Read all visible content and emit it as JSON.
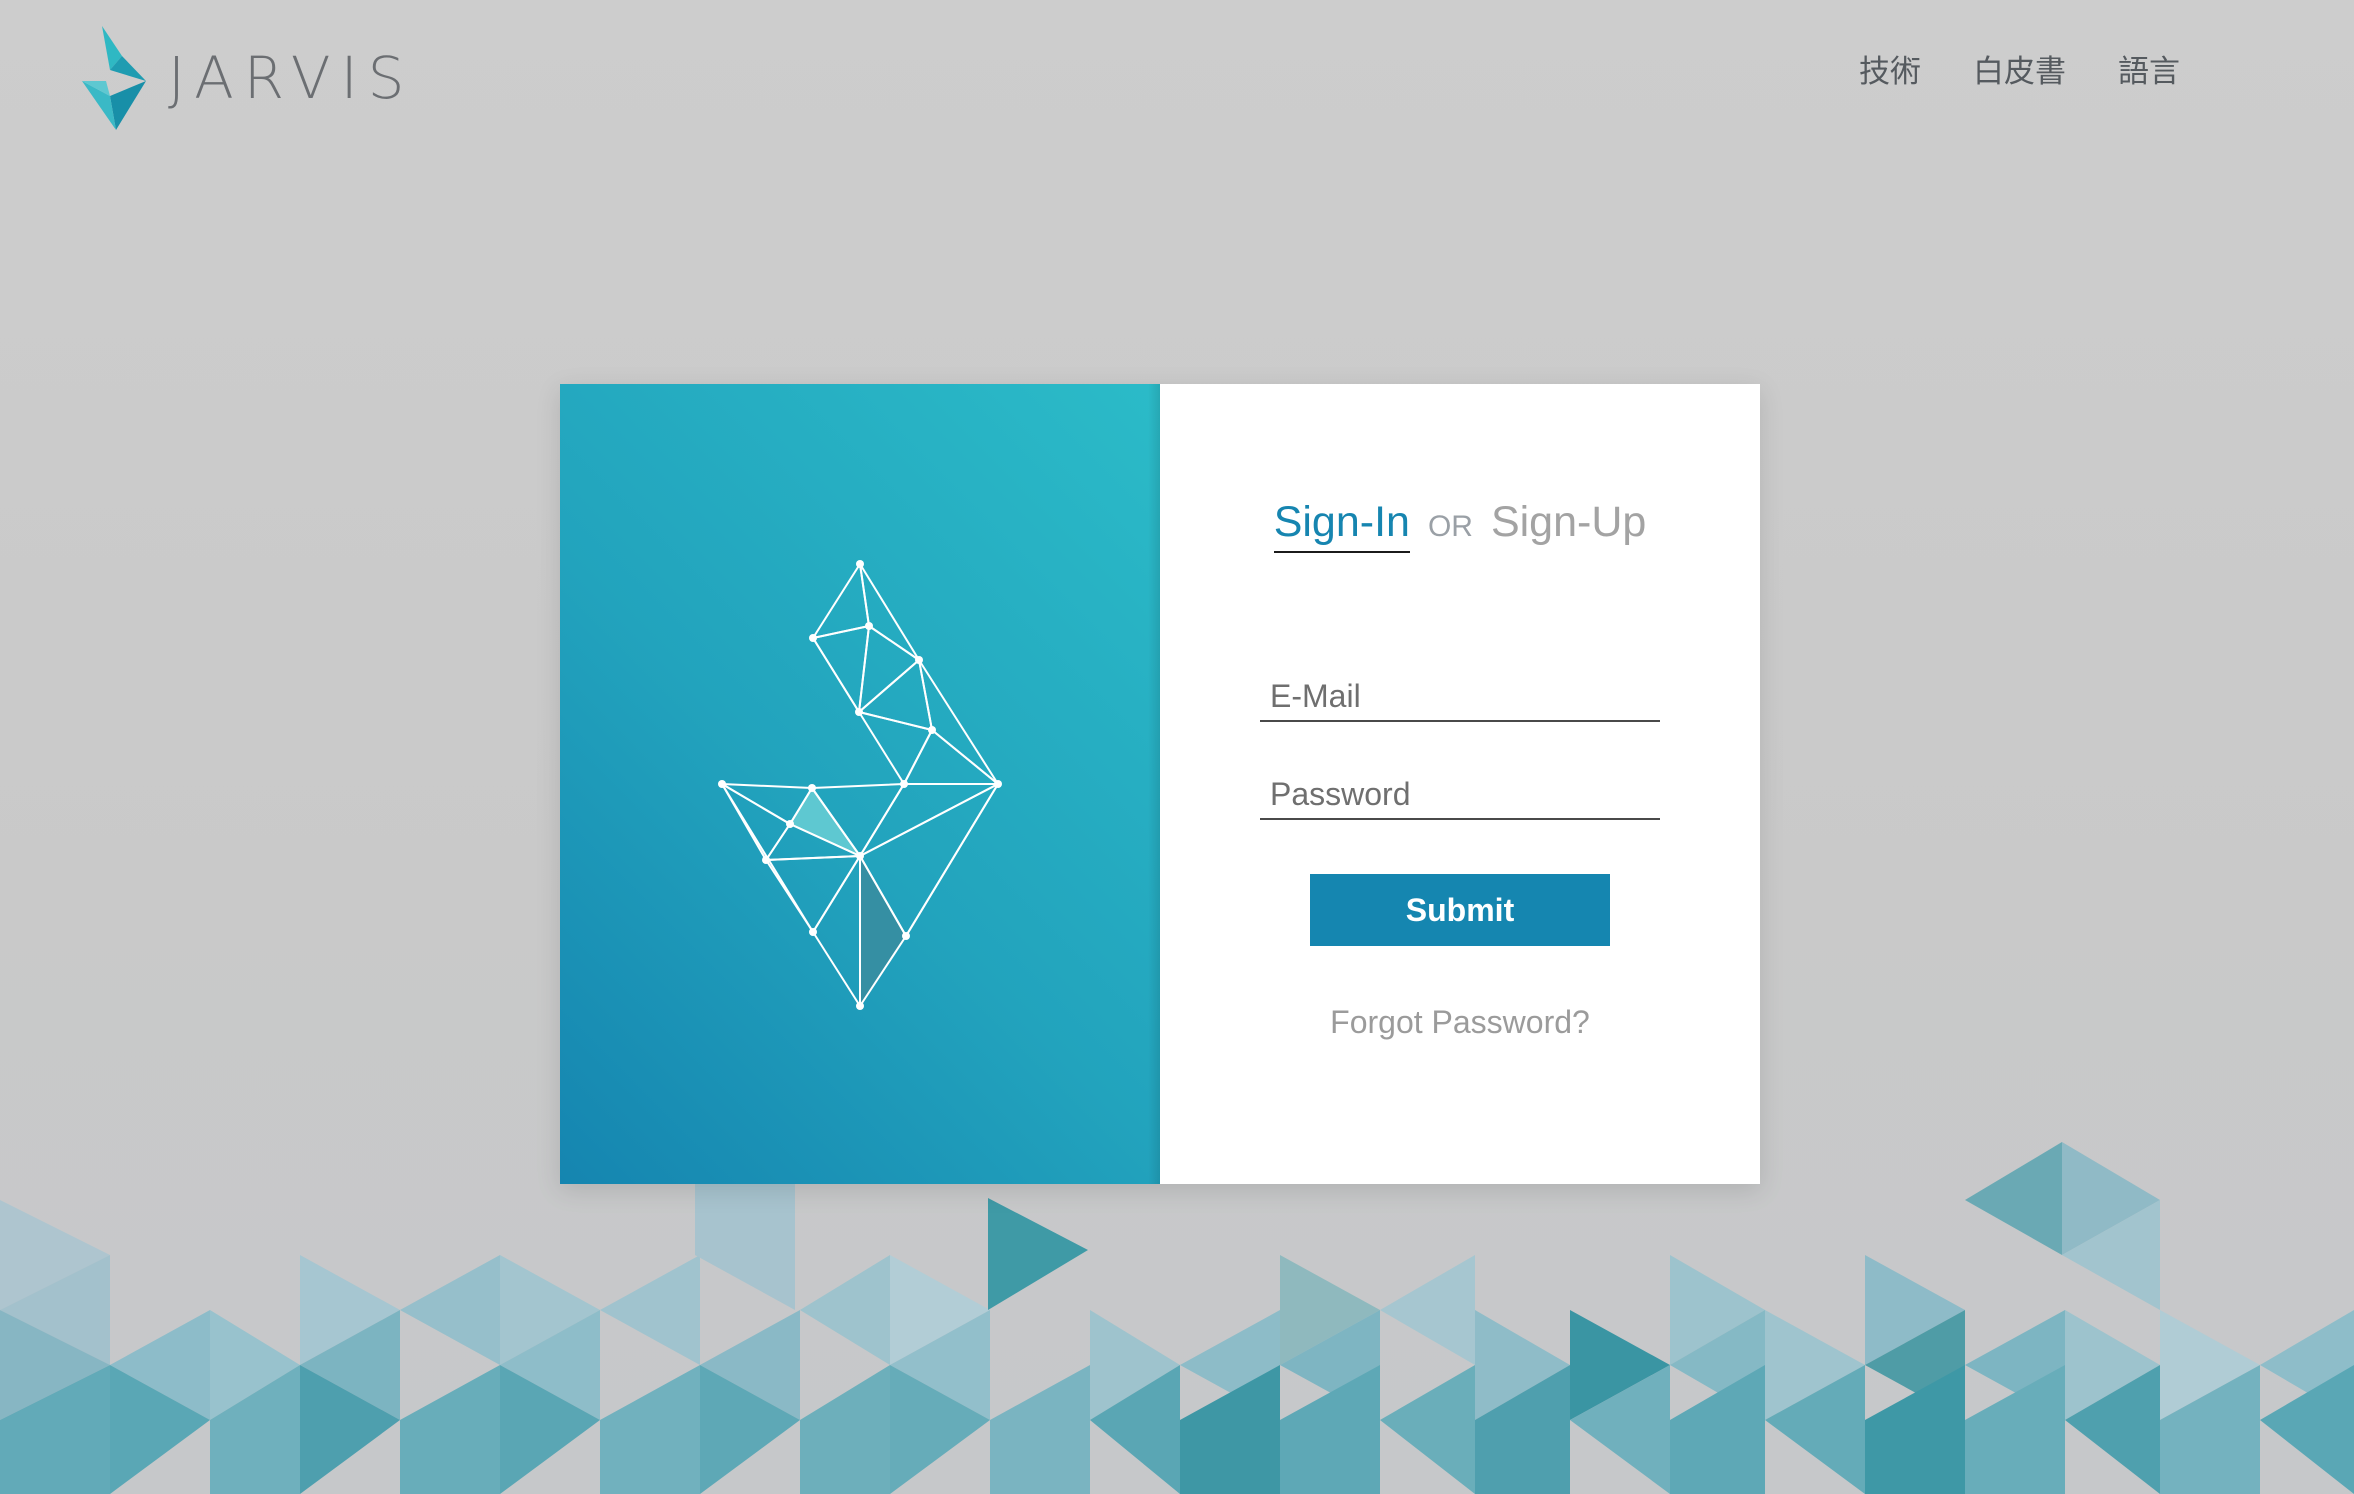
{
  "brand": {
    "name": "JARVIS"
  },
  "nav": {
    "items": [
      "技術",
      "白皮書",
      "語言"
    ]
  },
  "auth": {
    "tabs": {
      "sign_in": "Sign-In",
      "or": "OR",
      "sign_up": "Sign-Up"
    },
    "email_placeholder": "E-Mail",
    "password_placeholder": "Password",
    "submit_label": "Submit",
    "forgot_label": "Forgot Password?"
  },
  "colors": {
    "accent": "#1586b0",
    "panel_gradient_top": "#2bbbc8",
    "panel_gradient_bottom": "#1585b0",
    "background": "#cbcbcb"
  }
}
